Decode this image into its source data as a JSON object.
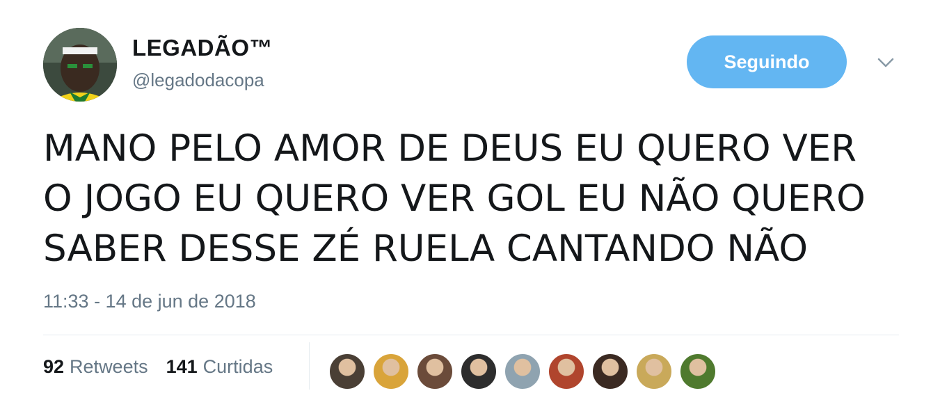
{
  "user": {
    "display_name": "LEGADÃO™",
    "handle": "@legadodacopa",
    "avatar_icon": "profile-avatar"
  },
  "follow_button": {
    "label": "Seguindo",
    "color": "#63b6f2"
  },
  "menu_icon": "chevron-down-icon",
  "tweet": {
    "text_lines": [
      "MANO PELO AMOR DE DEUS EU QUERO VER",
      "O JOGO EU QUERO VER GOL EU NÃO QUERO",
      "SABER DESSE ZÉ RUELA CANTANDO NÃO"
    ],
    "timestamp": "11:33 - 14 de jun de 2018"
  },
  "stats": {
    "retweets_count": "92",
    "retweets_label": "Retweets",
    "likes_count": "141",
    "likes_label": "Curtidas"
  },
  "likers": [
    {
      "name": "liker-avatar-1",
      "color": "#4a3f35"
    },
    {
      "name": "liker-avatar-2",
      "color": "#d9a43a"
    },
    {
      "name": "liker-avatar-3",
      "color": "#6b4b3a"
    },
    {
      "name": "liker-avatar-4",
      "color": "#2d2d2d"
    },
    {
      "name": "liker-avatar-5",
      "color": "#8fa3b0"
    },
    {
      "name": "liker-avatar-6",
      "color": "#b0452d"
    },
    {
      "name": "liker-avatar-7",
      "color": "#3b2a22"
    },
    {
      "name": "liker-avatar-8",
      "color": "#c9a95a"
    },
    {
      "name": "liker-avatar-9",
      "color": "#4f7a2e"
    }
  ]
}
